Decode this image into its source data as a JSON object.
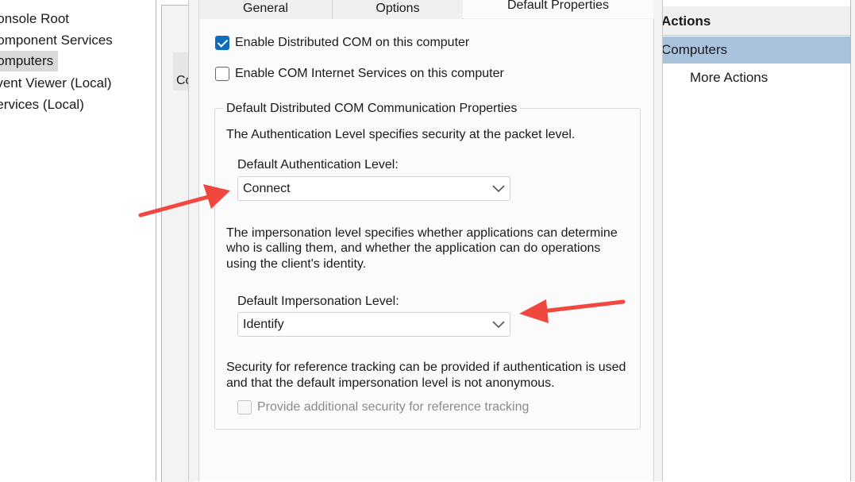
{
  "tree": {
    "items": [
      {
        "label": "Console Root",
        "selected": false
      },
      {
        "label": "Component Services",
        "selected": false
      },
      {
        "label": "Computers",
        "selected": true
      },
      {
        "label": "Event Viewer (Local)",
        "selected": false
      },
      {
        "label": "Services (Local)",
        "selected": false
      }
    ]
  },
  "middle": {
    "partial_text": "Co"
  },
  "actions": {
    "title": "Actions",
    "section": "Computers",
    "more": "More Actions"
  },
  "dialog": {
    "tabs": [
      {
        "label": "General",
        "active": false
      },
      {
        "label": "Options",
        "active": false
      },
      {
        "label": "Default Properties",
        "active": true
      }
    ],
    "enable_dcom": {
      "label": "Enable Distributed COM on this computer",
      "checked": true
    },
    "enable_cis": {
      "label": "Enable COM Internet Services on this computer",
      "checked": false
    },
    "group_title": "Default Distributed COM Communication Properties",
    "auth_desc": "The Authentication Level specifies security at the packet level.",
    "auth_label": "Default Authentication Level:",
    "auth_value": "Connect",
    "imp_desc_lines": [
      "The impersonation level specifies whether applications can determine",
      "who is calling them, and whether the application can do operations",
      "using the client's identity."
    ],
    "imp_label": "Default Impersonation Level:",
    "imp_value": "Identify",
    "ref_desc_lines": [
      "Security for reference tracking can be provided if authentication is used",
      "and that the default impersonation level is not anonymous."
    ],
    "ref_tracking": {
      "label": "Provide additional security for reference tracking",
      "checked": false,
      "disabled": true
    }
  },
  "colors": {
    "arrow": "#f0483e",
    "accent": "#0f6cbd",
    "selected_row": "#a9c3dc"
  }
}
